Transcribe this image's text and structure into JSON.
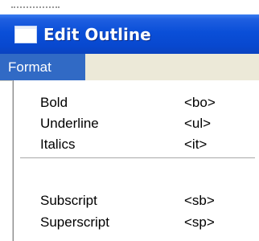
{
  "window": {
    "title": "Edit Outline",
    "icon": "window-icon"
  },
  "menubar": {
    "items": [
      {
        "label": "Format",
        "active": true
      }
    ],
    "active_color": "#316ac5"
  },
  "dropdown": {
    "groups": [
      [
        {
          "label": "Bold",
          "code": "<bo>"
        },
        {
          "label": "Underline",
          "code": "<ul>"
        },
        {
          "label": "Italics",
          "code": "<it>"
        }
      ],
      [
        {
          "label": "Subscript",
          "code": "<sb>"
        },
        {
          "label": "Superscript",
          "code": "<sp>"
        }
      ]
    ]
  },
  "colors": {
    "titlebar": "#0a4fd8",
    "menubar": "#ece9d8"
  }
}
